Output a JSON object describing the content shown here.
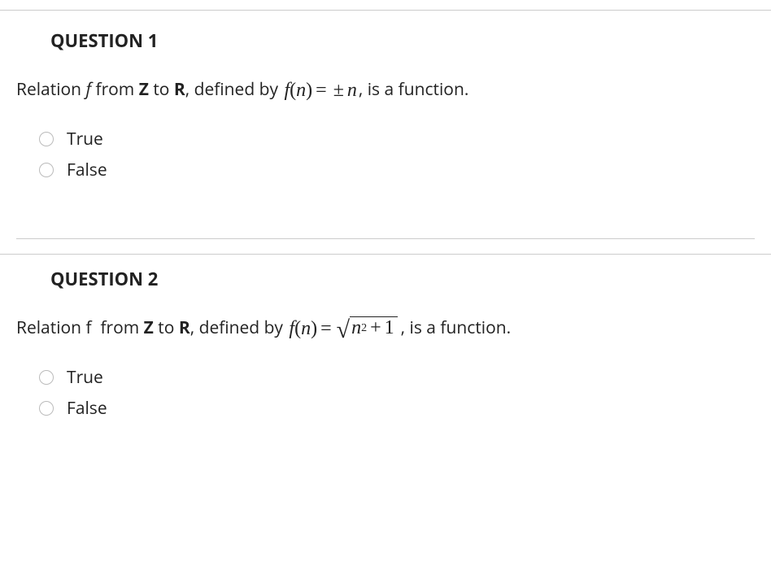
{
  "questions": [
    {
      "title": "QUESTION 1",
      "prompt_pre": "Relation ",
      "prompt_var": "f ",
      "prompt_from": "from ",
      "prompt_z": "Z",
      "prompt_to": " to ",
      "prompt_r": "R",
      "prompt_def": ", defined by ",
      "math_f": "f",
      "math_lp": "(",
      "math_n": "n",
      "math_rp": ")",
      "math_eq": " = ",
      "math_pm": " ± ",
      "math_n2": "n",
      "prompt_post": ", is a function.",
      "option_true": "True",
      "option_false": "False"
    },
    {
      "title": "QUESTION 2",
      "prompt_pre": "Relation f  from ",
      "prompt_z": "Z",
      "prompt_to": " to ",
      "prompt_r": "R",
      "prompt_def": ", defined by ",
      "math_f": "f",
      "math_lp": "(",
      "math_n": "n",
      "math_rp": ")",
      "math_eq": " = ",
      "sqrt_n": "n",
      "sqrt_exp": "2",
      "sqrt_plus": " + ",
      "sqrt_one": "1",
      "prompt_post": ", is a function.",
      "option_true": "True",
      "option_false": "False"
    }
  ]
}
